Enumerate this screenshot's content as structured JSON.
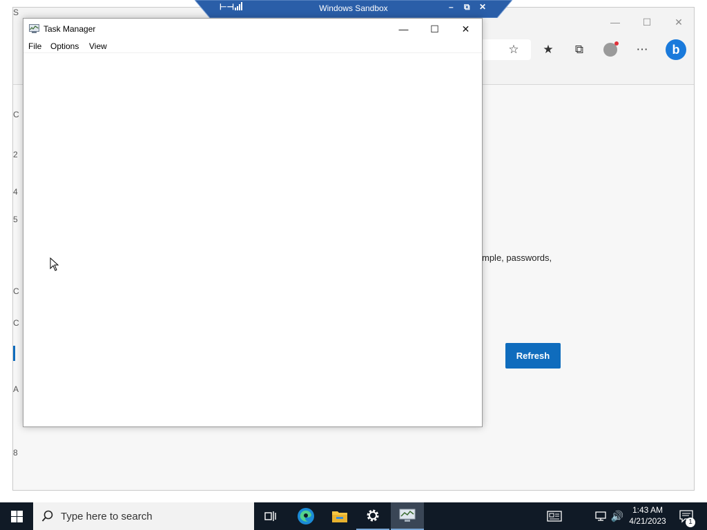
{
  "sandbox": {
    "title": "Windows Sandbox",
    "pin_icon": "pin-icon",
    "signal_icon": "signal-icon",
    "minimize_icon": "minimize-icon",
    "restore_icon": "restore-icon",
    "close_icon": "close-icon",
    "bar_color": "#2a5ea8"
  },
  "browser": {
    "minimize_icon": "minimize-icon",
    "maximize_icon": "maximize-icon",
    "close_icon": "close-icon",
    "toolbar_icons": [
      "add-favorite-icon",
      "favorites-icon",
      "collections-icon",
      "profile-icon",
      "more-icon",
      "bing-icon"
    ],
    "partial_text": "mple, passwords,",
    "refresh_label": "Refresh",
    "side_glyphs": [
      "S",
      "C",
      "2",
      "4",
      "5",
      "C",
      "C",
      "A",
      "8"
    ],
    "accent": "#0f6cbd"
  },
  "task_manager": {
    "title": "Task Manager",
    "menu": [
      "File",
      "Options",
      "View"
    ],
    "minimize_icon": "minimize-icon",
    "maximize_icon": "maximize-icon",
    "close_icon": "close-icon"
  },
  "taskbar": {
    "search_placeholder": "Type here to search",
    "apps": [
      "task-view-icon",
      "edge-icon",
      "file-explorer-icon",
      "settings-icon",
      "task-manager-icon"
    ],
    "time": "1:43 AM",
    "date": "4/21/2023",
    "notification_count": "1",
    "tray_icons": [
      "news-icon",
      "network-icon",
      "volume-icon",
      "notification-icon"
    ],
    "color": "#101a26"
  }
}
